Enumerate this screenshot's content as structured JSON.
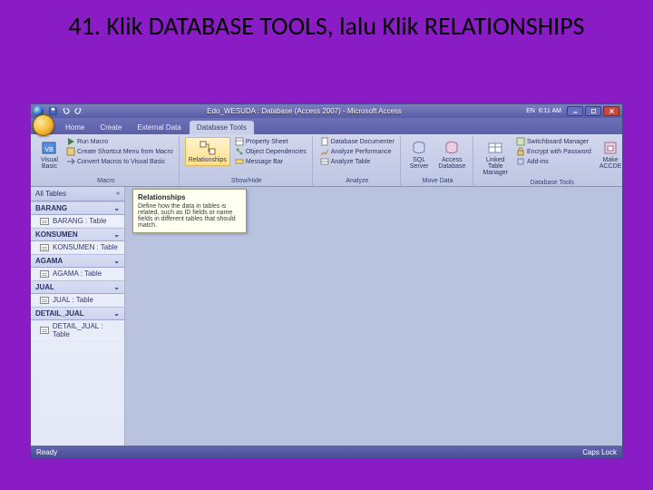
{
  "slide": {
    "title": "41. Klik DATABASE TOOLS, lalu Klik RELATIONSHIPS"
  },
  "titlebar": {
    "caption": "Edo_WESUDA : Database (Access 2007) - Microsoft Access",
    "time": "6:11 AM",
    "lang": "EN"
  },
  "tabs": {
    "home": "Home",
    "create": "Create",
    "external": "External Data",
    "dbtools": "Database Tools"
  },
  "ribbon": {
    "macro": {
      "vb": "Visual Basic",
      "run": "Run Macro",
      "shortcut": "Create Shortcut Menu from Macro",
      "convert": "Convert Macros to Visual Basic",
      "label": "Macro"
    },
    "showhide": {
      "relationships": "Relationships",
      "prop": "Property Sheet",
      "deps": "Object Dependencies",
      "msgbar": "Message Bar",
      "label": "Show/Hide"
    },
    "analyze": {
      "doc": "Database Documenter",
      "perf": "Analyze Performance",
      "table": "Analyze Table",
      "label": "Analyze"
    },
    "move": {
      "sql": "SQL Server",
      "access": "Access Database",
      "label": "Move Data"
    },
    "dbtools": {
      "linked": "Linked Table Manager",
      "switchboard": "Switchboard Manager",
      "encrypt": "Encrypt with Password",
      "addins": "Add-ins",
      "accde": "Make ACCDE",
      "label": "Database Tools"
    }
  },
  "nav": {
    "header": "All Tables",
    "categories": [
      {
        "name": "BARANG",
        "items": [
          "BARANG : Table"
        ]
      },
      {
        "name": "KONSUMEN",
        "items": [
          "KONSUMEN : Table"
        ]
      },
      {
        "name": "AGAMA",
        "items": [
          "AGAMA : Table"
        ]
      },
      {
        "name": "JUAL",
        "items": [
          "JUAL : Table"
        ]
      },
      {
        "name": "DETAIL_JUAL",
        "items": [
          "DETAIL_JUAL : Table"
        ]
      }
    ]
  },
  "tooltip": {
    "title": "Relationships",
    "body": "Define how the data in tables is related, such as ID fields or name fields in different tables that should match."
  },
  "status": {
    "left": "Ready",
    "right": "Caps Lock"
  }
}
